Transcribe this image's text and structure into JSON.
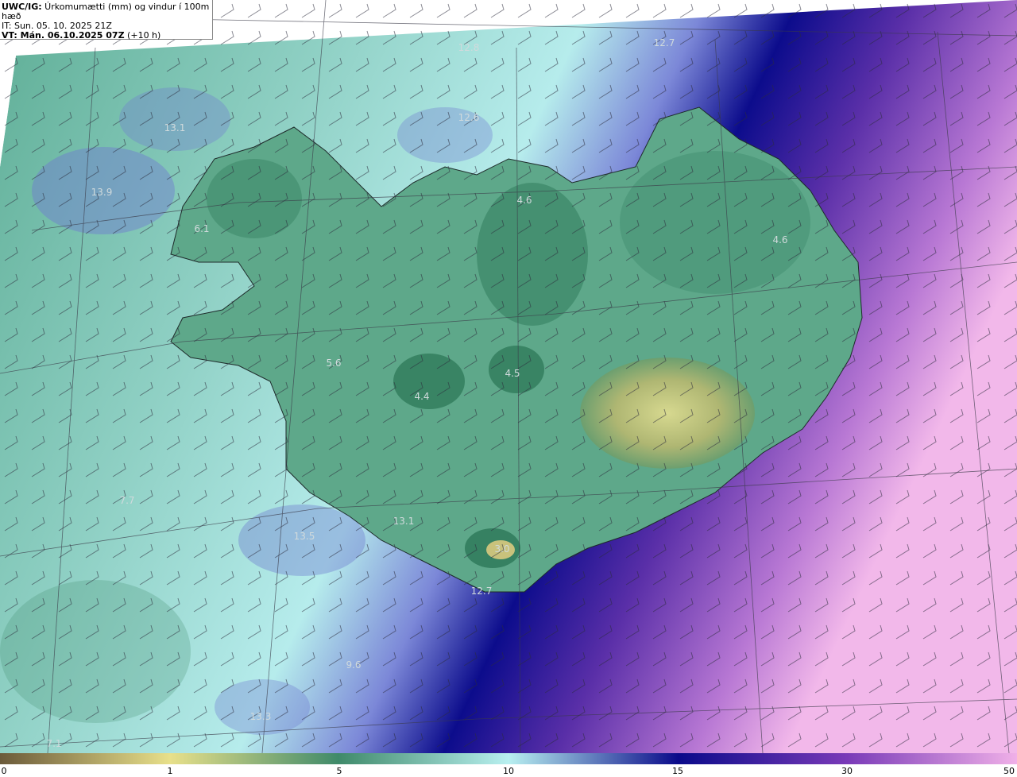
{
  "header": {
    "title_prefix": "UWC/IG:",
    "title_rest": " Úrkomumætti (mm) og vindur í 100m hæð",
    "it_line": "IT: Sun. 05. 10. 2025 21Z",
    "vt_prefix": "VT: Mán. 06.10.2025 07Z",
    "vt_suffix": " (+10 h)"
  },
  "value_labels": [
    "12.8",
    "12.7",
    "12.6",
    "13.1",
    "13.9",
    "6.1",
    "4.6",
    "4.6",
    "5.6",
    "4.5",
    "4.4",
    "13.1",
    "13.5",
    "3.0",
    "12.7",
    "9.6",
    "13.3",
    "7.1",
    "7.7"
  ],
  "colorbar": {
    "ticks": [
      "0",
      "1",
      "5",
      "10",
      "15",
      "30",
      "50"
    ],
    "colors": [
      "#6b5a3a",
      "#e8e08a",
      "#3f8a6a",
      "#b8f0f0",
      "#0a0a8a",
      "#7a3ab8",
      "#f0b0e8"
    ]
  },
  "colors": {
    "land_green": "#3f8a6a",
    "sea_light": "#9fd6d4",
    "deep_blue": "#0c0c8c",
    "purple": "#6c3ab0",
    "pink": "#e9a8e0"
  }
}
